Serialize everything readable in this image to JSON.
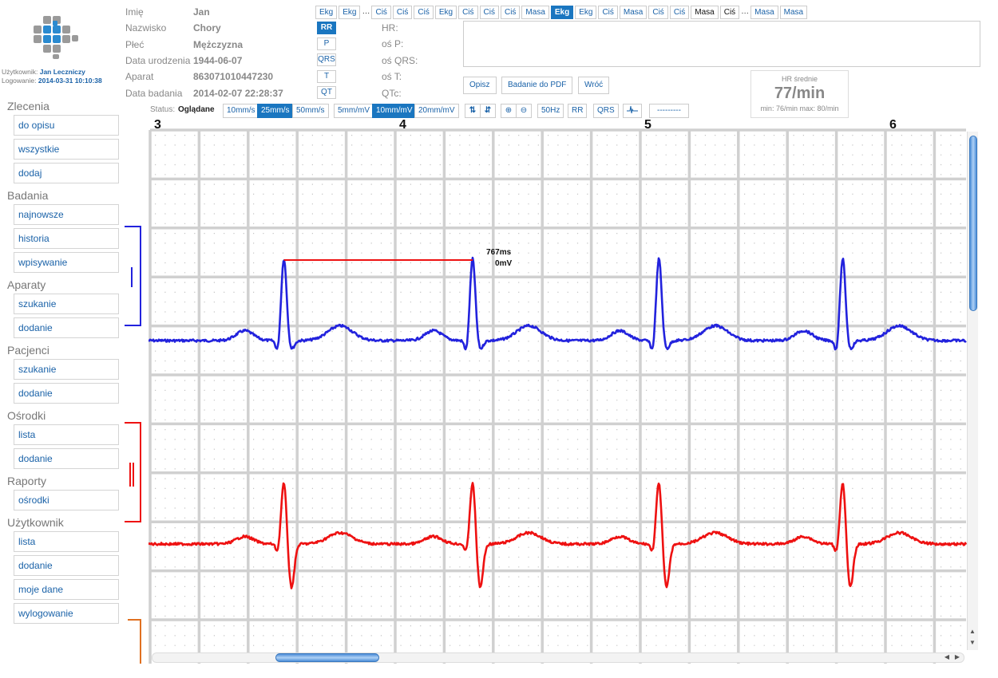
{
  "user": {
    "label_user": "Użytkownik:",
    "name": "Jan Leczniczy",
    "label_login": "Logowanie:",
    "login_time": "2014-03-31 10:10:38"
  },
  "nav": [
    {
      "title": "Zlecenia",
      "items": [
        "do opisu",
        "wszystkie",
        "dodaj"
      ]
    },
    {
      "title": "Badania",
      "items": [
        "najnowsze",
        "historia",
        "wpisywanie"
      ]
    },
    {
      "title": "Aparaty",
      "items": [
        "szukanie",
        "dodanie"
      ]
    },
    {
      "title": "Pacjenci",
      "items": [
        "szukanie",
        "dodanie"
      ]
    },
    {
      "title": "Ośrodki",
      "items": [
        "lista",
        "dodanie"
      ]
    },
    {
      "title": "Raporty",
      "items": [
        "ośrodki"
      ]
    },
    {
      "title": "Użytkownik",
      "items": [
        "lista",
        "dodanie",
        "moje dane",
        "wylogowanie"
      ]
    }
  ],
  "patient": {
    "rows": [
      {
        "label": "Imię",
        "value": "Jan"
      },
      {
        "label": "Nazwisko",
        "value": "Chory"
      },
      {
        "label": "Płeć",
        "value": "Mężczyzna"
      },
      {
        "label": "Data urodzenia",
        "value": "1944-06-07"
      },
      {
        "label": "Aparat",
        "value": "863071010447230"
      },
      {
        "label": "Data badania",
        "value": "2014-02-07 22:28:37"
      }
    ]
  },
  "wave_buttons": [
    "RR",
    "P",
    "QRS",
    "T",
    "QT"
  ],
  "params": [
    "HR:",
    "oś P:",
    "oś QRS:",
    "oś T:",
    "QTc:"
  ],
  "history_tabs": [
    "Ekg",
    "Ekg",
    "…",
    "Ciś",
    "Ciś",
    "Ciś",
    "Ekg",
    "Ciś",
    "Ciś",
    "Ciś",
    "Masa",
    "Ekg",
    "Ekg",
    "Ciś",
    "Masa",
    "Ciś",
    "Ciś",
    "Masa",
    "Ciś",
    "…",
    "Masa",
    "Masa"
  ],
  "actions": [
    "Opisz",
    "Badanie do PDF",
    "Wróć"
  ],
  "hr": {
    "title": "HR średnie",
    "value": "77/min",
    "min_label": "min:",
    "min": "76/min",
    "max_label": "max:",
    "max": "80/min"
  },
  "toolbar": {
    "status_label": "Status:",
    "status_value": "Oglądane",
    "speed": [
      "10mm/s",
      "25mm/s",
      "50mm/s"
    ],
    "gain": [
      "5mm/mV",
      "10mm/mV",
      "20mm/mV"
    ],
    "filter": "50Hz",
    "rr": "RR",
    "qrs": "QRS",
    "dashes": "---------"
  },
  "chart_data": {
    "type": "line",
    "seconds": [
      "3",
      "4",
      "5",
      "6"
    ],
    "measurement": {
      "duration": "767ms",
      "amplitude": "0mV"
    },
    "series": [
      {
        "color": "#2222dd",
        "r_peaks_s": [
          3.52,
          4.29,
          5.05,
          5.8
        ]
      },
      {
        "color": "#ee1111",
        "r_peaks_s": [
          3.52,
          4.29,
          5.05,
          5.8
        ]
      }
    ]
  },
  "colors": {
    "accent": "#1a76c0",
    "link": "#1a62a8",
    "grid_major": "#d0d0d0",
    "grid_minor": "#c4c4c4"
  }
}
